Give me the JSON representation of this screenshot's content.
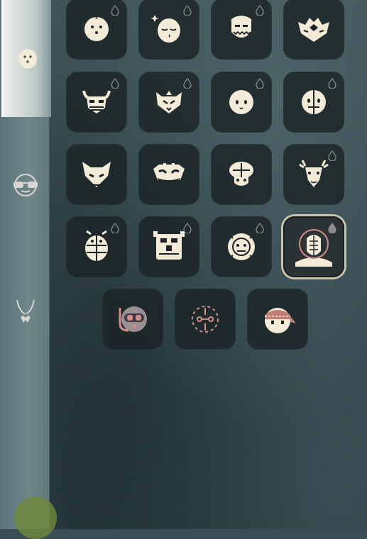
{
  "colors": {
    "cream": "#f4ead8",
    "dark": "#1c2326",
    "pink_accent": "#d08f8a",
    "sidebar": "#6f878b",
    "selected_border": "#c9c4ad"
  },
  "sidebar": {
    "tabs": [
      {
        "icon": "mask-face-icon",
        "active": true
      },
      {
        "icon": "glasses-icon",
        "active": false
      },
      {
        "icon": "necklace-icon",
        "active": false
      }
    ]
  },
  "masks": [
    {
      "icon": "round-mask-icon",
      "has_drop": true
    },
    {
      "icon": "sleeping-mask-icon",
      "has_drop": true
    },
    {
      "icon": "shield-mask-icon",
      "has_drop": true
    },
    {
      "icon": "crown-mask-icon",
      "has_drop": false
    },
    {
      "icon": "horned-mask-icon",
      "has_drop": true
    },
    {
      "icon": "cat-mask-icon",
      "has_drop": true
    },
    {
      "icon": "simple-face-mask-icon",
      "has_drop": true
    },
    {
      "icon": "split-mask-icon",
      "has_drop": true
    },
    {
      "icon": "fox-mask-icon",
      "has_drop": false
    },
    {
      "icon": "tribal-mask-icon",
      "has_drop": false
    },
    {
      "icon": "mushroom-mask-icon",
      "has_drop": false
    },
    {
      "icon": "deer-mask-icon",
      "has_drop": true
    },
    {
      "icon": "beetle-mask-icon",
      "has_drop": true
    },
    {
      "icon": "totem-mask-icon",
      "has_drop": true
    },
    {
      "icon": "lion-mask-icon",
      "has_drop": true
    },
    {
      "icon": "hooded-mask-icon",
      "has_drop": true,
      "selected": true
    },
    {
      "icon": "diving-mask-icon",
      "has_drop": false
    },
    {
      "icon": "target-mask-icon",
      "has_drop": false
    },
    {
      "icon": "bandana-mask-icon",
      "has_drop": false
    }
  ]
}
